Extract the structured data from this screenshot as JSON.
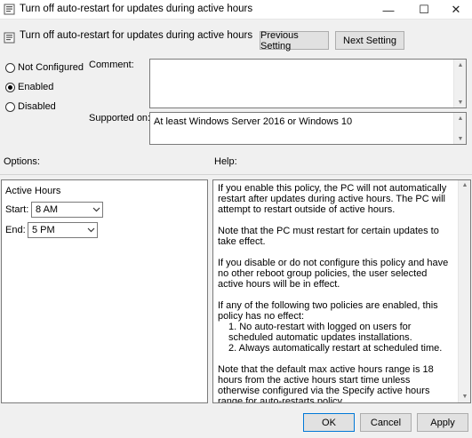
{
  "window": {
    "title": "Turn off auto-restart for updates during active hours",
    "minimize": "—",
    "maximize": "☐",
    "close": "✕"
  },
  "header": {
    "policy_title": "Turn off auto-restart for updates during active hours",
    "prev_label": "Previous Setting",
    "next_label": "Next Setting"
  },
  "state": {
    "options": [
      "Not Configured",
      "Enabled",
      "Disabled"
    ],
    "selected": "Enabled"
  },
  "comment": {
    "label": "Comment:",
    "value": ""
  },
  "supported": {
    "label": "Supported on:",
    "value": "At least Windows Server 2016 or Windows 10"
  },
  "options_panel": {
    "label": "Options:",
    "section_title": "Active Hours",
    "start_label": "Start:",
    "start_value": "8 AM",
    "end_label": "End:",
    "end_value": "5 PM"
  },
  "help": {
    "label": "Help:",
    "p1": "If you enable this policy, the PC will not automatically restart after updates during active hours. The PC will attempt to restart outside of active hours.",
    "p2": "Note that the PC must restart for certain updates to take effect.",
    "p3": "If you disable or do not configure this policy and have no other reboot group policies, the user selected active hours will be in effect.",
    "p4": "If any of the following two policies are enabled, this policy has no effect:",
    "p4_item1": "1. No auto-restart with logged on users for scheduled automatic updates installations.",
    "p4_item2": "2. Always automatically restart at scheduled time.",
    "p5": "Note that the default max active hours range is 18 hours from the active hours start time unless otherwise configured via the Specify active hours range for auto-restarts policy."
  },
  "footer": {
    "ok_label": "OK",
    "cancel_label": "Cancel",
    "apply_label": "Apply"
  }
}
